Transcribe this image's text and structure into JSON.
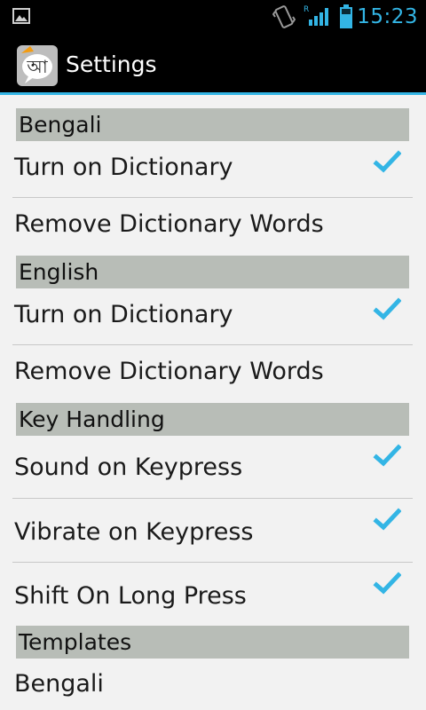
{
  "status_bar": {
    "time": "15:23",
    "icons": [
      "gallery-icon",
      "vibrate-icon",
      "signal-roaming-icon",
      "battery-icon"
    ],
    "roaming_indicator": "R"
  },
  "action_bar": {
    "title": "Settings",
    "app_icon": "bengali-keyboard-app-icon",
    "app_icon_glyph": "আ"
  },
  "colors": {
    "accent": "#33b5e5",
    "category_bg": "#b8bdb7",
    "background": "#f2f2f2"
  },
  "settings": {
    "sections": [
      {
        "header": "Bengali",
        "items": [
          {
            "label": "Turn on Dictionary",
            "checked": true
          },
          {
            "label": "Remove Dictionary Words",
            "checked": null
          }
        ]
      },
      {
        "header": "English",
        "items": [
          {
            "label": "Turn on Dictionary",
            "checked": true
          },
          {
            "label": "Remove Dictionary Words",
            "checked": null
          }
        ]
      },
      {
        "header": "Key Handling",
        "items": [
          {
            "label": "Sound on Keypress",
            "checked": true
          },
          {
            "label": "Vibrate on Keypress",
            "checked": true
          },
          {
            "label": "Shift On Long Press",
            "checked": true
          }
        ]
      },
      {
        "header": "Templates",
        "items": [
          {
            "label": "Bengali",
            "checked": null
          }
        ]
      }
    ]
  }
}
